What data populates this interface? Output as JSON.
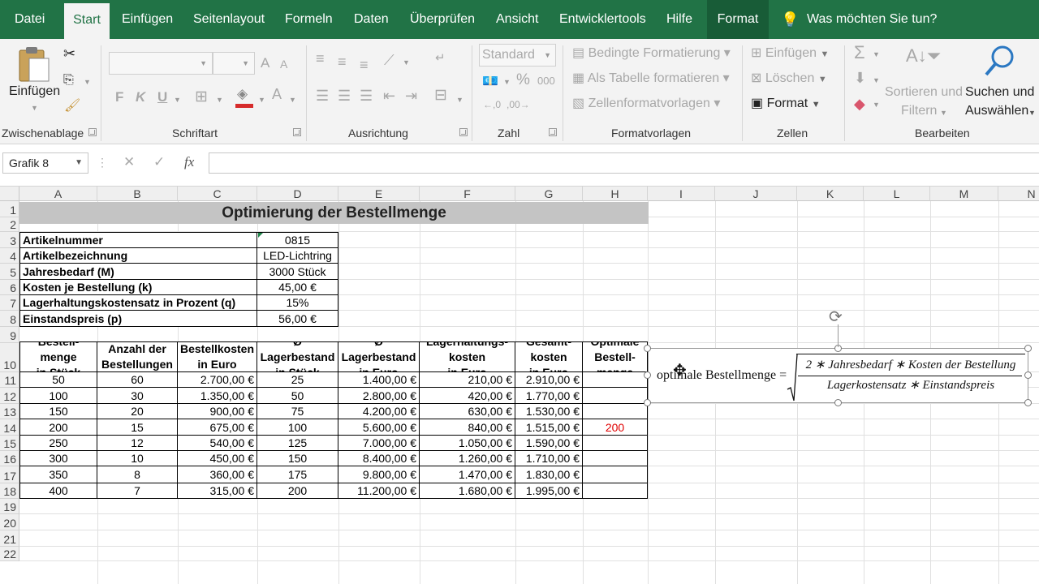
{
  "ribbon_tabs": [
    {
      "label": "Datei"
    },
    {
      "label": "Start"
    },
    {
      "label": "Einfügen"
    },
    {
      "label": "Seitenlayout"
    },
    {
      "label": "Formeln"
    },
    {
      "label": "Daten"
    },
    {
      "label": "Überprüfen"
    },
    {
      "label": "Ansicht"
    },
    {
      "label": "Entwicklertools"
    },
    {
      "label": "Hilfe"
    },
    {
      "label": "Format"
    }
  ],
  "tell_me": "Was möchten Sie tun?",
  "ribbon": {
    "clipboard": {
      "paste": "Einfügen",
      "group": "Zwischenablage"
    },
    "font": {
      "bold": "F",
      "italic": "K",
      "underline": "U",
      "grow": "A",
      "shrink": "A",
      "font_color": "A",
      "group": "Schriftart"
    },
    "alignment": {
      "group": "Ausrichtung"
    },
    "number": {
      "format": "Standard",
      "percent": "%",
      "thousands": "000",
      "group": "Zahl"
    },
    "styles": {
      "conditional": "Bedingte Formatierung",
      "as_table": "Als Tabelle formatieren",
      "cell_styles": "Zellenformatvorlagen",
      "group": "Formatvorlagen"
    },
    "cells": {
      "insert": "Einfügen",
      "delete": "Löschen",
      "format": "Format",
      "group": "Zellen"
    },
    "editing": {
      "sort_1": "Sortieren und",
      "sort_2": "Filtern",
      "find_1": "Suchen und",
      "find_2": "Auswählen",
      "group": "Bearbeiten"
    }
  },
  "name_box": "Grafik 8",
  "formula_bar": {
    "cancel": "✕",
    "enter": "✓",
    "fx": "fx"
  },
  "columns": [
    "A",
    "B",
    "C",
    "D",
    "E",
    "F",
    "G",
    "H",
    "I",
    "J",
    "K",
    "L",
    "M",
    "N"
  ],
  "rows": [
    "1",
    "2",
    "3",
    "4",
    "5",
    "6",
    "7",
    "8",
    "9",
    "10",
    "11",
    "12",
    "13",
    "14",
    "15",
    "16",
    "17",
    "18",
    "19",
    "20",
    "21",
    "22"
  ],
  "sheet": {
    "title": "Optimierung der Bestellmenge",
    "info": [
      {
        "label": "Artikelnummer",
        "value": "0815"
      },
      {
        "label": "Artikelbezeichnung",
        "value": "LED-Lichtring"
      },
      {
        "label": "Jahresbedarf (M)",
        "value": "3000 Stück"
      },
      {
        "label": "Kosten je Bestellung (k)",
        "value": "45,00 €"
      },
      {
        "label": "Lagerhaltungskostensatz in Prozent (q)",
        "value": "15%"
      },
      {
        "label": "Einstandspreis (p)",
        "value": "56,00 €"
      }
    ],
    "headers": [
      [
        "Bestell-",
        "menge",
        "in Stück"
      ],
      [
        "Anzahl der",
        "Bestellungen"
      ],
      [
        "Bestellkosten",
        "in Euro"
      ],
      [
        "Ø",
        "Lagerbestand",
        "in Stück"
      ],
      [
        "Ø",
        "Lagerbestand",
        "in Euro"
      ],
      [
        "Lagerhaltungs-",
        "kosten",
        "in Euro"
      ],
      [
        "Gesamt-",
        "kosten",
        "in Euro"
      ],
      [
        "Optimale",
        "Bestell-",
        "menge"
      ]
    ],
    "data": [
      [
        "50",
        "60",
        "2.700,00 €",
        "25",
        "1.400,00 €",
        "210,00 €",
        "2.910,00 €",
        ""
      ],
      [
        "100",
        "30",
        "1.350,00 €",
        "50",
        "2.800,00 €",
        "420,00 €",
        "1.770,00 €",
        ""
      ],
      [
        "150",
        "20",
        "900,00 €",
        "75",
        "4.200,00 €",
        "630,00 €",
        "1.530,00 €",
        ""
      ],
      [
        "200",
        "15",
        "675,00 €",
        "100",
        "5.600,00 €",
        "840,00 €",
        "1.515,00 €",
        "200"
      ],
      [
        "250",
        "12",
        "540,00 €",
        "125",
        "7.000,00 €",
        "1.050,00 €",
        "1.590,00 €",
        ""
      ],
      [
        "300",
        "10",
        "450,00 €",
        "150",
        "8.400,00 €",
        "1.260,00 €",
        "1.710,00 €",
        ""
      ],
      [
        "350",
        "8",
        "360,00 €",
        "175",
        "9.800,00 €",
        "1.470,00 €",
        "1.830,00 €",
        ""
      ],
      [
        "400",
        "7",
        "315,00 €",
        "200",
        "11.200,00 €",
        "1.680,00 €",
        "1.995,00 €",
        ""
      ]
    ],
    "optimal_color": "#e00000"
  },
  "equation": {
    "label": "optimale Bestellmenge =",
    "numerator": "2 ∗ Jahresbedarf ∗ Kosten der Bestellung",
    "denominator": "Lagerkostensatz ∗ Einstandspreis"
  },
  "colors": {
    "accent": "#217346",
    "ribbon_bg": "#f3f3f3"
  }
}
